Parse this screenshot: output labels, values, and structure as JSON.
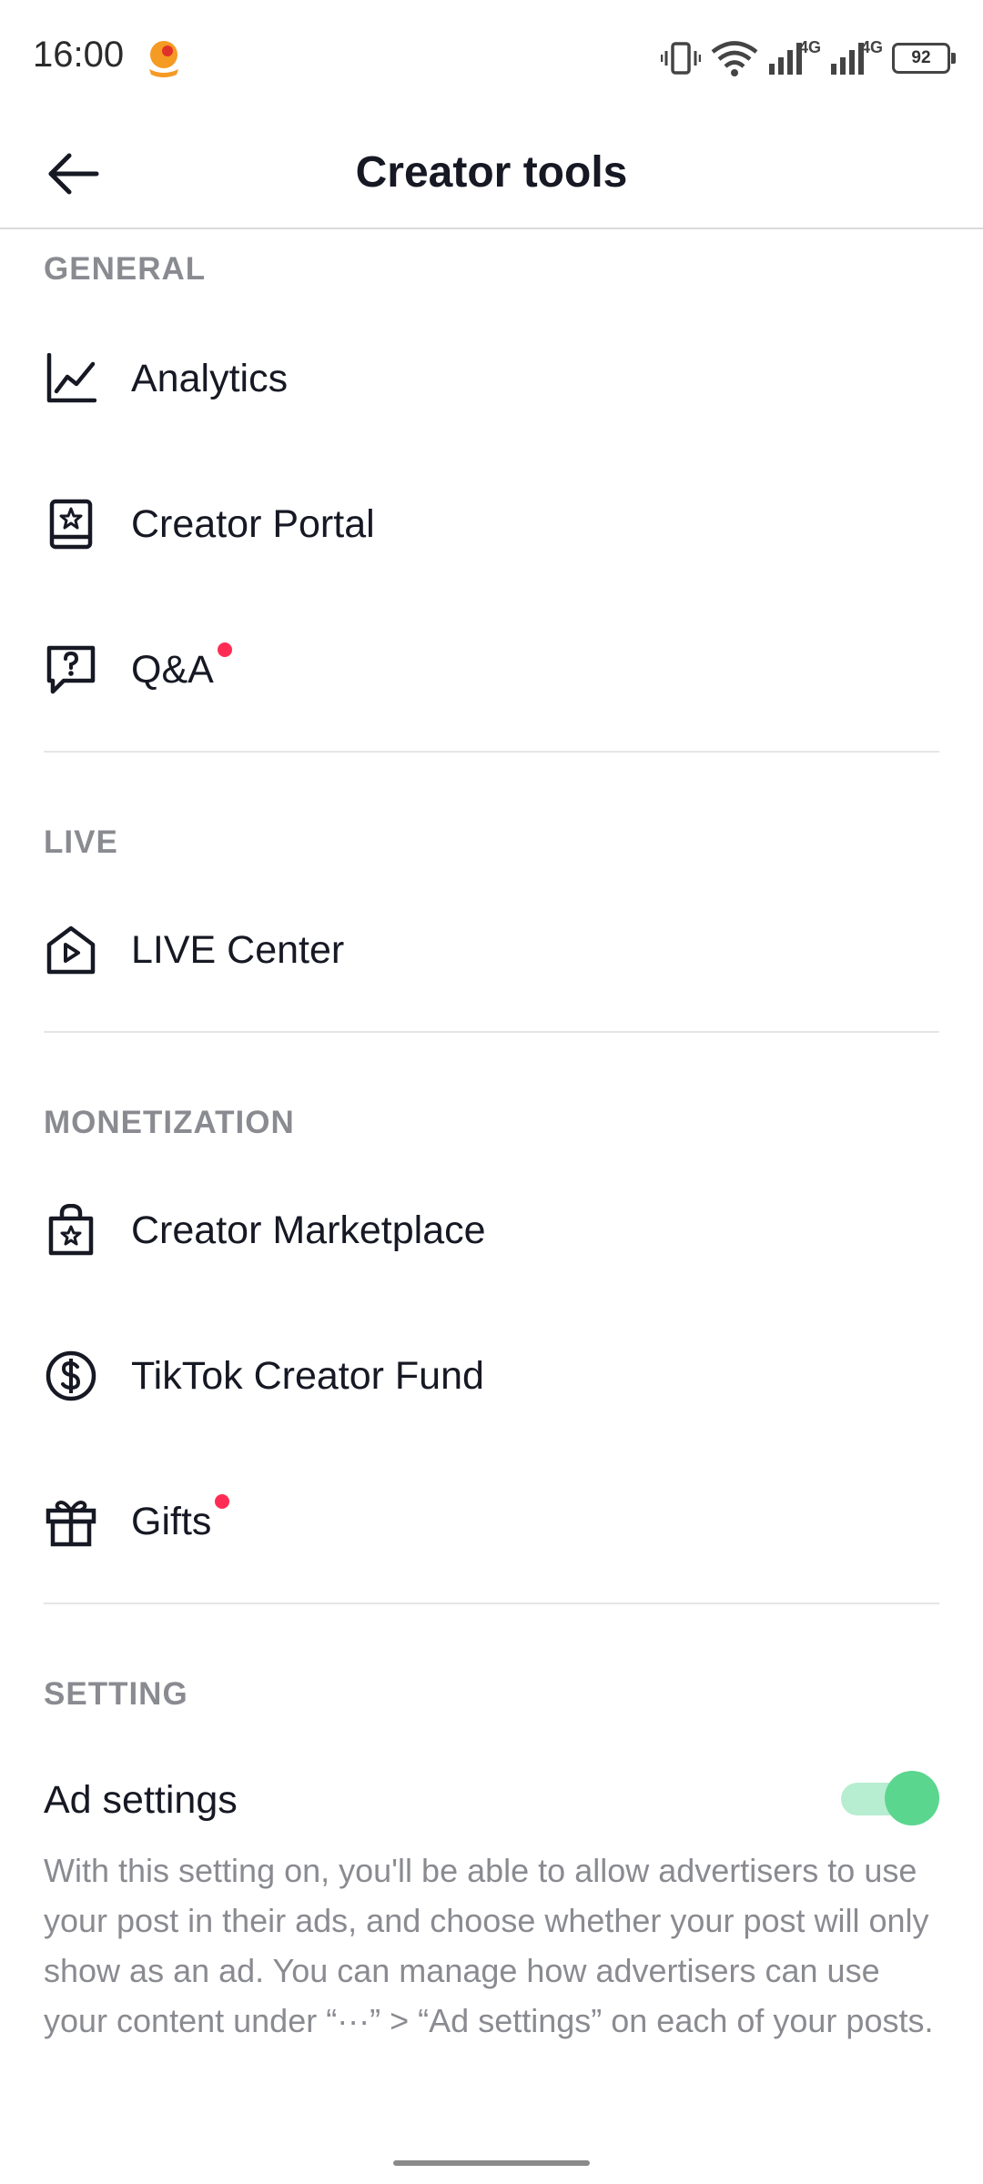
{
  "status_bar": {
    "time": "16:00",
    "net_label_1": "4G",
    "net_label_2": "4G",
    "battery": "92"
  },
  "header": {
    "title": "Creator tools",
    "back_icon": "arrow-left-icon"
  },
  "sections": {
    "general": {
      "label": "GENERAL",
      "items": [
        {
          "label": "Analytics",
          "icon": "analytics-chart-icon"
        },
        {
          "label": "Creator Portal",
          "icon": "book-star-icon"
        },
        {
          "label": "Q&A",
          "icon": "question-bubble-icon",
          "has_dot": true
        }
      ]
    },
    "live": {
      "label": "LIVE",
      "items": [
        {
          "label": "LIVE Center",
          "icon": "live-home-icon"
        }
      ]
    },
    "monetization": {
      "label": "MONETIZATION",
      "items": [
        {
          "label": "Creator Marketplace",
          "icon": "shopping-bag-star-icon"
        },
        {
          "label": "TikTok Creator Fund",
          "icon": "dollar-circle-icon"
        },
        {
          "label": "Gifts",
          "icon": "gift-icon",
          "has_dot": true
        }
      ]
    },
    "setting": {
      "label": "SETTING",
      "ad_settings": {
        "label": "Ad settings",
        "enabled": true,
        "description": "With this setting on, you'll be able to allow advertisers to use your post in their ads, and choose whether your post will only show as an ad. You can manage how advertisers can use your content under “···” > “Ad settings” on each of your posts."
      }
    }
  },
  "colors": {
    "accent_dot": "#fe2c55",
    "toggle_on": "#5bd68f",
    "section_label": "#8a8b91"
  }
}
